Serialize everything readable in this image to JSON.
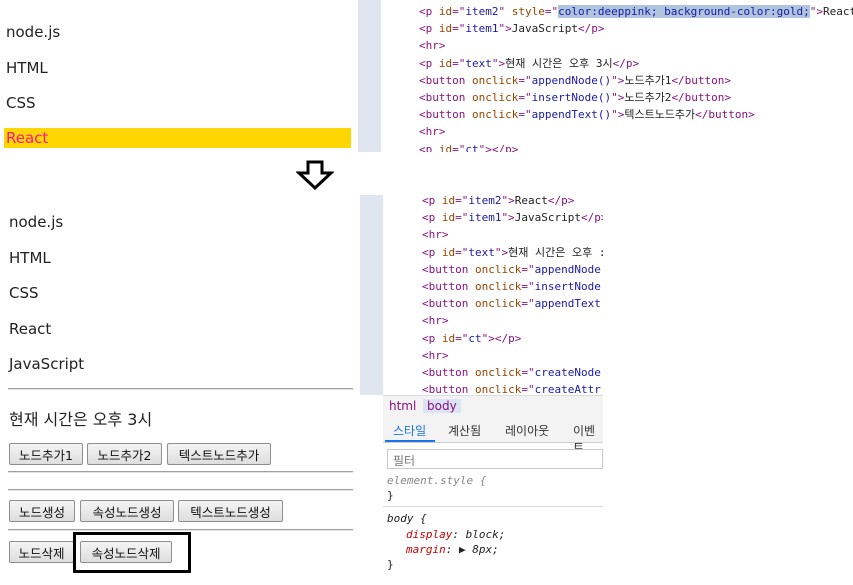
{
  "top": {
    "page_items": [
      "node.js",
      "HTML",
      "CSS",
      "React"
    ],
    "code_lines": [
      {
        "kind": "p_styled",
        "id": "item2",
        "style": "color:deeppink; background-color:gold;",
        "text": "React"
      },
      {
        "kind": "p",
        "id": "item1",
        "text": "JavaScript"
      },
      {
        "kind": "hr"
      },
      {
        "kind": "p",
        "id": "text",
        "text": "현재 시간은 오후 3시"
      },
      {
        "kind": "button",
        "onclick": "appendNode()",
        "text": "노드추가1"
      },
      {
        "kind": "button",
        "onclick": "insertNode()",
        "text": "노드추가2"
      },
      {
        "kind": "button",
        "onclick": "appendText()",
        "text": "텍스트노드추가"
      },
      {
        "kind": "hr"
      },
      {
        "kind": "p_cut",
        "id": "ct"
      }
    ],
    "colors": {
      "react_fg": "#ff1493",
      "react_bg": "#ffd700"
    }
  },
  "arrow": {
    "icon": "down-arrow-icon"
  },
  "bottom": {
    "page_items": [
      "node.js",
      "HTML",
      "CSS",
      "React",
      "JavaScript"
    ],
    "time_text": "현재 시간은 오후 3시",
    "buttons_row1": [
      "노드추가1",
      "노드추가2",
      "텍스트노드추가"
    ],
    "buttons_row2": [
      "노드생성",
      "속성노드생성",
      "텍스트노드생성"
    ],
    "buttons_row3": [
      "노드삭제",
      "속성노드삭제"
    ],
    "code_lines": [
      {
        "kind": "p",
        "id": "item2",
        "text": "React"
      },
      {
        "kind": "p",
        "id": "item1",
        "text": "JavaScript"
      },
      {
        "kind": "hr"
      },
      {
        "kind": "p_cut_text",
        "id": "text",
        "text": "현재 시간은 오후 :"
      },
      {
        "kind": "button_cut",
        "onclick": "appendNode()"
      },
      {
        "kind": "button_cut",
        "onclick": "insertNode()"
      },
      {
        "kind": "button_cut",
        "onclick": "appendText()"
      },
      {
        "kind": "hr"
      },
      {
        "kind": "p_empty",
        "id": "ct"
      },
      {
        "kind": "hr"
      },
      {
        "kind": "button_cut",
        "onclick": "createNode()"
      },
      {
        "kind": "button_cut",
        "onclick": "createAttr()"
      }
    ],
    "breadcrumbs": [
      "html",
      "body"
    ],
    "tabs": [
      "스타일",
      "계산됨",
      "레이아웃",
      "이벤트"
    ],
    "filter_placeholder": "필터",
    "styles": {
      "element_style": "element.style {",
      "close": "}",
      "body_selector": "body {",
      "display_prop": "display",
      "display_val": "block;",
      "margin_prop": "margin",
      "margin_val": "▶ 8px;"
    }
  }
}
